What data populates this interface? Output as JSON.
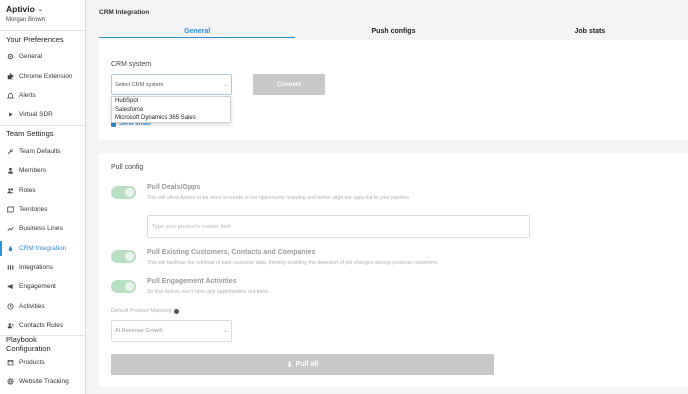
{
  "sidebar": {
    "brand": "Aptivio",
    "user": "Morgan Brown",
    "sections": [
      {
        "title": "Your Preferences",
        "items": [
          {
            "label": "General",
            "icon": "gear-icon"
          },
          {
            "label": "Chrome Extension",
            "icon": "puzzle-icon"
          },
          {
            "label": "Alerts",
            "icon": "bell-icon"
          },
          {
            "label": "Virtual SDR",
            "icon": "play-icon"
          }
        ]
      },
      {
        "title": "Team Settings",
        "items": [
          {
            "label": "Team Defaults",
            "icon": "wrench-icon"
          },
          {
            "label": "Members",
            "icon": "user-icon"
          },
          {
            "label": "Roles",
            "icon": "users-icon"
          },
          {
            "label": "Territories",
            "icon": "map-icon"
          },
          {
            "label": "Business Lines",
            "icon": "line-chart-icon"
          },
          {
            "label": "CRM Integration",
            "icon": "drop-icon"
          },
          {
            "label": "Integrations",
            "icon": "grid-icon"
          },
          {
            "label": "Engagement",
            "icon": "megaphone-icon"
          },
          {
            "label": "Activities",
            "icon": "clock-icon"
          },
          {
            "label": "Contacts Rules",
            "icon": "contacts-icon"
          }
        ]
      },
      {
        "title": "Playbook Configuration",
        "items": [
          {
            "label": "Products",
            "icon": "box-icon"
          },
          {
            "label": "Website Tracking",
            "icon": "globe-icon"
          }
        ]
      }
    ]
  },
  "main": {
    "title": "CRM Integration",
    "tabs": [
      "General",
      "Push configs",
      "Job stats"
    ],
    "crm": {
      "label": "CRM system",
      "select_placeholder": "Select CRM system",
      "connect_label": "Connect",
      "options": [
        "HubSpot",
        "Salesforce",
        "Microsoft Dynamics 365 Sales"
      ],
      "send_email_label": "Send email"
    },
    "pull": {
      "title": "Pull config",
      "deals_title": "Pull Deals/Opps",
      "deals_desc": "This will allow Aptivio to be more accurate in our opportunity mapping and better align our opps list to your pipeline",
      "custom_field_placeholder": "Type your product's custom field",
      "customers_title": "Pull Existing Customers, Contacts and Companies",
      "customers_desc": "This will facilitate the retrieval of past customer data, thereby enabling the detection of job changes among previous customers.",
      "engagement_title": "Pull Engagement Activities",
      "engagement_desc": "So that Aptivio won't miss any opportunities out there",
      "mapping_label": "Default Product Mapping",
      "mapping_value": "AI Revenue Growth",
      "pull_all_label": "Pull all"
    }
  }
}
